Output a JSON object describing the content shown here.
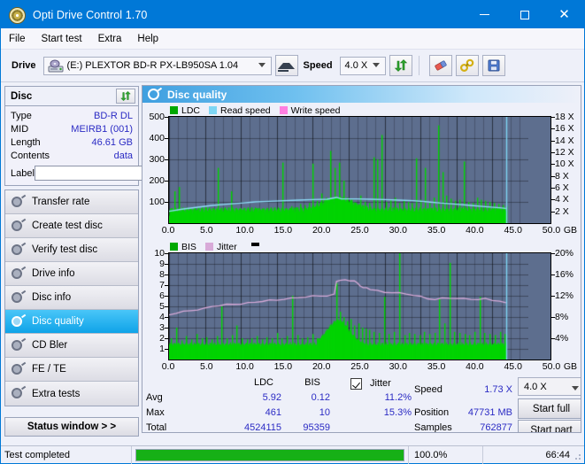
{
  "window": {
    "title": "Opti Drive Control 1.70",
    "icon": "disc-icon",
    "minimize": "–",
    "maximize": "□",
    "close": "✕"
  },
  "menu": [
    "File",
    "Start test",
    "Extra",
    "Help"
  ],
  "toolbar": {
    "drive_label": "Drive",
    "drive_value": "(E:)  PLEXTOR BD-R  PX-LB950SA 1.04",
    "eject_icon": "eject-icon",
    "speed_label": "Speed",
    "speed_value": "4.0 X",
    "refresh_icon": "refresh-icon",
    "erase_icon": "eraser-icon",
    "tools_icon": "tools-icon",
    "save_icon": "save-icon"
  },
  "sidebar": {
    "disc_panel": {
      "title": "Disc",
      "refresh_icon": "refresh-icon",
      "rows": [
        {
          "key": "Type",
          "value": "BD-R DL"
        },
        {
          "key": "MID",
          "value": "MEIRB1 (001)"
        },
        {
          "key": "Length",
          "value": "46.61 GB"
        },
        {
          "key": "Contents",
          "value": "data"
        }
      ],
      "label_key": "Label",
      "label_value": "",
      "label_placeholder": "",
      "disc_button_icon": "cd-icon"
    },
    "nav": [
      {
        "label": "Transfer rate",
        "selected": false
      },
      {
        "label": "Create test disc",
        "selected": false
      },
      {
        "label": "Verify test disc",
        "selected": false
      },
      {
        "label": "Drive info",
        "selected": false
      },
      {
        "label": "Disc info",
        "selected": false
      },
      {
        "label": "Disc quality",
        "selected": true
      },
      {
        "label": "CD Bler",
        "selected": false
      },
      {
        "label": "FE / TE",
        "selected": false
      },
      {
        "label": "Extra tests",
        "selected": false
      }
    ],
    "status_window_button": "Status window > >"
  },
  "main": {
    "header": "Disc quality",
    "header_icon": "disc-quality-icon"
  },
  "stats": {
    "col_headers": [
      "LDC",
      "BIS"
    ],
    "row_headers": [
      "Avg",
      "Max",
      "Total"
    ],
    "ldc": {
      "avg": "5.92",
      "max": "461",
      "total": "4524115"
    },
    "bis": {
      "avg": "0.12",
      "max": "10",
      "total": "95359"
    },
    "jitter": {
      "label": "Jitter",
      "checked": true,
      "avg": "11.2%",
      "max": "15.3%"
    },
    "speed_label": "Speed",
    "speed_value": "1.73 X",
    "position_label": "Position",
    "position_value": "47731 MB",
    "samples_label": "Samples",
    "samples_value": "762877",
    "speed_select": "4.0 X",
    "start_full": "Start full",
    "start_part": "Start part"
  },
  "statusbar": {
    "message": "Test completed",
    "progress_percent": "100.0%",
    "progress_value": 100,
    "elapsed": "66:44"
  },
  "colors": {
    "accent": "#0078d7",
    "plot_bg": "#5d6e8e",
    "ldc_green": "#00d400",
    "bis_green": "#00d400",
    "read_speed": "#7fd6f4",
    "write_speed": "#ff7fe0",
    "jitter_pink": "#d8aad8",
    "value_blue": "#2b2bc4",
    "progress_green": "#16b016"
  },
  "chart_data": [
    {
      "type": "line",
      "id": "disc-quality-ldc",
      "title": "",
      "legend": [
        {
          "name": "LDC",
          "color": "#00a800",
          "swatch": "#00a800"
        },
        {
          "name": "Read speed",
          "color": "#7fd6f4",
          "swatch": "#7fd6f4"
        },
        {
          "name": "Write speed",
          "color": "#ff7fe0",
          "swatch": "#ff7fe0"
        }
      ],
      "legend_position": "top-left",
      "grid": true,
      "xlabel": "GB",
      "xlim": [
        0,
        50
      ],
      "xticks": [
        "0.0",
        "5.0",
        "10.0",
        "15.0",
        "20.0",
        "25.0",
        "30.0",
        "35.0",
        "40.0",
        "45.0",
        "50.0"
      ],
      "ylabel": "LDC",
      "ylim": [
        0,
        500
      ],
      "yticks": [
        "100",
        "200",
        "300",
        "400",
        "500"
      ],
      "y2label": "Speed",
      "y2lim": [
        0,
        18
      ],
      "y2ticks": [
        "2 X",
        "4 X",
        "6 X",
        "8 X",
        "10 X",
        "12 X",
        "14 X",
        "16 X",
        "18 X"
      ],
      "series": [
        {
          "name": "LDC",
          "color": "#00d400",
          "style": "impulse",
          "x": [
            0.2,
            0.8,
            1.4,
            2.0,
            2.6,
            3.2,
            3.8,
            4.4,
            5.0,
            5.6,
            6.2,
            6.8,
            7.4,
            8.0,
            8.6,
            9.2,
            9.8,
            10.4,
            11.0,
            11.6,
            12.2,
            12.8,
            13.4,
            14.0,
            14.6,
            15.2,
            15.8,
            16.4,
            17.0,
            17.6,
            18.2,
            18.8,
            19.4,
            20.0,
            20.6,
            21.2,
            21.8,
            22.4,
            23.0,
            23.6,
            24.2,
            24.8,
            25.4,
            26.0,
            26.6,
            27.2,
            27.8,
            28.4,
            29.0,
            29.6,
            30.2,
            30.8,
            31.4,
            32.0,
            32.6,
            33.2,
            33.8,
            34.4,
            35.0,
            35.6,
            36.2,
            36.8,
            37.4,
            38.0,
            38.6,
            39.2,
            39.8,
            40.4,
            41.0,
            41.6,
            42.2,
            42.8,
            43.4,
            44.0,
            44.6,
            45.2,
            45.8,
            46.4,
            46.9
          ],
          "values": [
            60,
            150,
            170,
            50,
            40,
            45,
            55,
            60,
            75,
            65,
            60,
            260,
            55,
            60,
            150,
            50,
            45,
            55,
            60,
            50,
            70,
            60,
            55,
            65,
            60,
            70,
            285,
            60,
            80,
            75,
            90,
            85,
            95,
            280,
            105,
            140,
            120,
            340,
            260,
            285,
            200,
            120,
            110,
            95,
            130,
            100,
            95,
            310,
            300,
            415,
            100,
            110,
            120,
            95,
            105,
            100,
            95,
            305,
            110,
            260,
            100,
            120,
            460,
            240,
            130,
            115,
            105,
            110,
            290,
            100,
            95,
            120,
            110,
            105,
            100,
            95,
            90,
            85,
            80
          ]
        },
        {
          "name": "Read speed",
          "color": "#8fdcf8",
          "style": "line",
          "x": [
            0,
            2,
            4,
            6,
            8,
            10,
            12,
            14,
            16,
            18,
            20,
            22,
            23.3,
            24,
            26,
            28,
            30,
            32,
            34,
            36,
            38,
            40,
            42,
            44,
            46,
            46.9
          ],
          "values": [
            2.0,
            2.4,
            2.7,
            3.0,
            3.2,
            3.4,
            3.6,
            3.7,
            3.8,
            3.9,
            4.0,
            4.05,
            4.35,
            4.1,
            4.1,
            4.05,
            4.0,
            3.9,
            3.8,
            3.6,
            3.4,
            3.2,
            3.0,
            2.8,
            2.6,
            2.5
          ]
        },
        {
          "name": "Write speed",
          "color": "#ff7fe0",
          "style": "line",
          "x": [],
          "values": []
        }
      ],
      "marker_line": {
        "x": 46.9,
        "color": "#7fd6f4"
      }
    },
    {
      "type": "line",
      "id": "disc-quality-bis",
      "title": "",
      "legend": [
        {
          "name": "BIS",
          "color": "#00a800",
          "swatch": "#00a800"
        },
        {
          "name": "Jitter",
          "color": "#d8aad8",
          "swatch": "#d8aad8"
        }
      ],
      "legend_position": "top-left",
      "grid": true,
      "xlabel": "GB",
      "xlim": [
        0,
        50
      ],
      "xticks": [
        "0.0",
        "5.0",
        "10.0",
        "15.0",
        "20.0",
        "25.0",
        "30.0",
        "35.0",
        "40.0",
        "45.0",
        "50.0"
      ],
      "ylabel": "BIS",
      "ylim": [
        0,
        10
      ],
      "yticks": [
        "1",
        "2",
        "3",
        "4",
        "5",
        "6",
        "7",
        "8",
        "9",
        "10"
      ],
      "y2label": "Jitter",
      "y2lim": [
        0,
        20
      ],
      "y2ticks": [
        "4%",
        "8%",
        "12%",
        "16%",
        "20%"
      ],
      "series": [
        {
          "name": "BIS",
          "color": "#00d400",
          "style": "area-impulse",
          "baseline": 1.4,
          "x": [
            0.3,
            1.0,
            1.7,
            2.4,
            3.1,
            3.8,
            4.5,
            5.2,
            5.9,
            6.6,
            7.3,
            8.0,
            8.7,
            9.4,
            10.1,
            10.8,
            11.5,
            12.2,
            12.9,
            13.6,
            14.3,
            15.0,
            15.7,
            16.4,
            17.1,
            17.8,
            18.5,
            19.2,
            19.9,
            20.6,
            21.3,
            22.0,
            22.7,
            23.3,
            23.8,
            24.3,
            24.8,
            25.3,
            25.8,
            26.3,
            26.8,
            27.3,
            27.8,
            28.5,
            29.2,
            29.9,
            30.6,
            31.3,
            32.0,
            32.7,
            33.4,
            34.1,
            34.8,
            35.5,
            36.2,
            36.9,
            37.6,
            38.3,
            39.0,
            39.7,
            40.4,
            41.1,
            41.8,
            42.5,
            43.2,
            43.9,
            44.6,
            45.3,
            46.0,
            46.7
          ],
          "values": [
            2.0,
            3.0,
            1.8,
            2.2,
            1.9,
            2.4,
            2.0,
            2.1,
            1.9,
            2.2,
            5.0,
            2.0,
            2.3,
            3.2,
            2.0,
            1.9,
            2.0,
            2.2,
            1.9,
            2.1,
            2.0,
            2.5,
            2.0,
            2.2,
            6.0,
            2.3,
            2.0,
            2.1,
            2.4,
            2.0,
            2.2,
            2.1,
            2.6,
            7.2,
            4.5,
            4.0,
            3.6,
            3.8,
            3.2,
            3.4,
            3.0,
            2.9,
            2.8,
            2.6,
            2.5,
            5.9,
            2.4,
            2.6,
            10.0,
            2.3,
            2.5,
            2.4,
            2.3,
            2.6,
            2.4,
            2.5,
            5.7,
            3.4,
            9.1,
            2.6,
            2.5,
            2.4,
            2.3,
            2.6,
            5.9,
            2.5,
            2.4,
            2.3,
            2.6,
            2.4
          ]
        },
        {
          "name": "Jitter",
          "color": "#d8aad8",
          "style": "line",
          "x": [
            0,
            1,
            2,
            3,
            4,
            5,
            6,
            7,
            8,
            9,
            10,
            11,
            12,
            13,
            14,
            15,
            16,
            17,
            18,
            19,
            20,
            21,
            22,
            23,
            23.3,
            23.8,
            24.5,
            25.2,
            25.8,
            26.2,
            26.6,
            27,
            27.5,
            28,
            29,
            30,
            31,
            32,
            33,
            34,
            35,
            36,
            37,
            38,
            39,
            40,
            41,
            42,
            43,
            44,
            45,
            46,
            46.9
          ],
          "values": [
            8.4,
            8.8,
            9.0,
            9.2,
            9.4,
            9.6,
            10.0,
            10.2,
            10.3,
            10.4,
            10.5,
            10.6,
            10.8,
            11.0,
            11.1,
            11.2,
            11.4,
            11.5,
            11.7,
            11.8,
            11.9,
            12.0,
            12.0,
            12.2,
            14.8,
            14.9,
            14.9,
            14.8,
            14.7,
            14.3,
            13.8,
            13.6,
            13.4,
            13.2,
            12.9,
            12.7,
            12.6,
            12.5,
            12.4,
            12.1,
            11.8,
            11.5,
            11.3,
            11.5,
            11.6,
            11.5,
            11.4,
            11.4,
            11.3,
            11.4,
            11.2,
            11.0,
            10.8
          ]
        }
      ],
      "marker_line": {
        "x": 46.9,
        "color": "#7fd6f4"
      }
    }
  ]
}
